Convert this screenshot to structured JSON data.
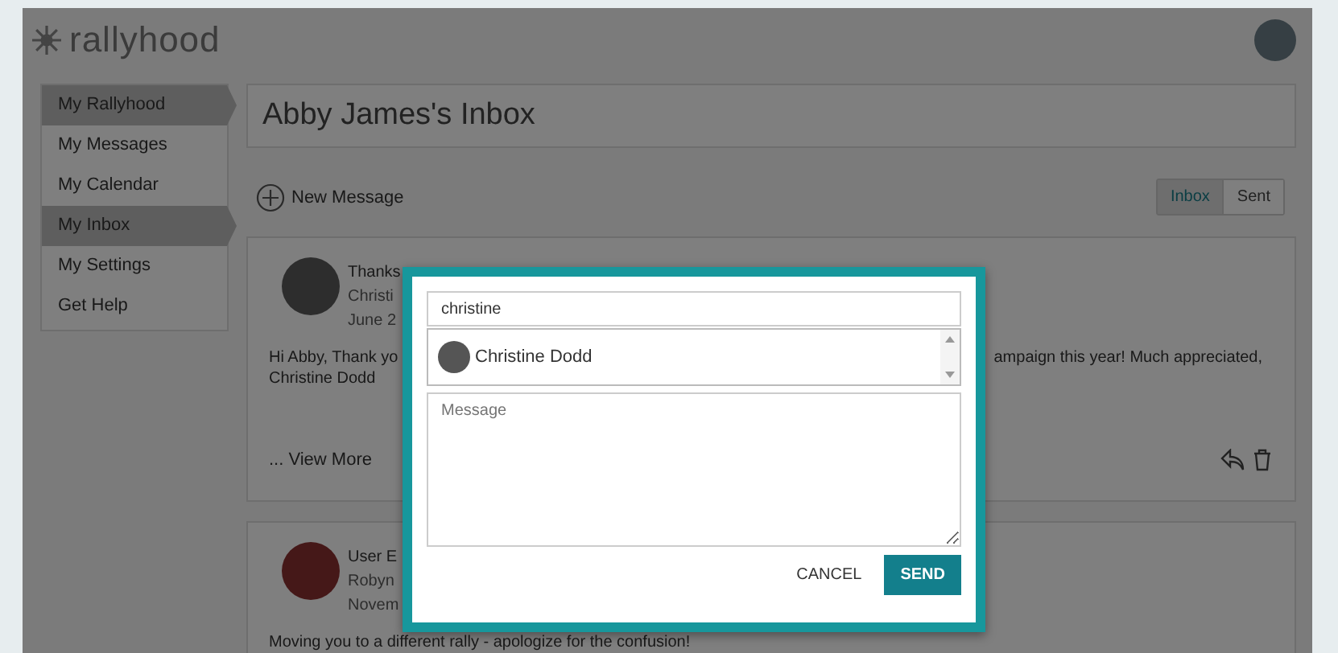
{
  "header": {
    "logo": "rallyhood"
  },
  "sidebar": {
    "items": [
      {
        "label": "My Rallyhood",
        "selected": true
      },
      {
        "label": "My Messages",
        "selected": false
      },
      {
        "label": "My Calendar",
        "selected": false
      },
      {
        "label": "My Inbox",
        "selected": true
      },
      {
        "label": "My Settings",
        "selected": false
      },
      {
        "label": "Get Help",
        "selected": false
      }
    ]
  },
  "page_title": "Abby James's Inbox",
  "new_message": "New Message",
  "tabs": [
    {
      "label": "Inbox",
      "selected": true
    },
    {
      "label": "Sent",
      "selected": false
    }
  ],
  "messages": [
    {
      "subject": "Thanks",
      "sender": "Christi",
      "date": "June 2",
      "body_left": "Hi Abby, Thank yo",
      "body_right": "ampaign this year! Much appreciated,",
      "body_line2": "Christine Dodd",
      "view_more": "... View More"
    },
    {
      "subject": "User E",
      "sender": "Robyn",
      "date": "Novem",
      "body_left": "Moving you to a different rally - apologize for the confusion!"
    }
  ],
  "modal": {
    "recipient_field": {
      "value": "christine"
    },
    "suggestions": [
      {
        "name": "Christine Dodd"
      }
    ],
    "message_field": {
      "placeholder": "Message"
    },
    "buttons": [
      {
        "label": "CANCEL",
        "kind": "text"
      },
      {
        "label": "SEND",
        "kind": "primary"
      }
    ]
  }
}
